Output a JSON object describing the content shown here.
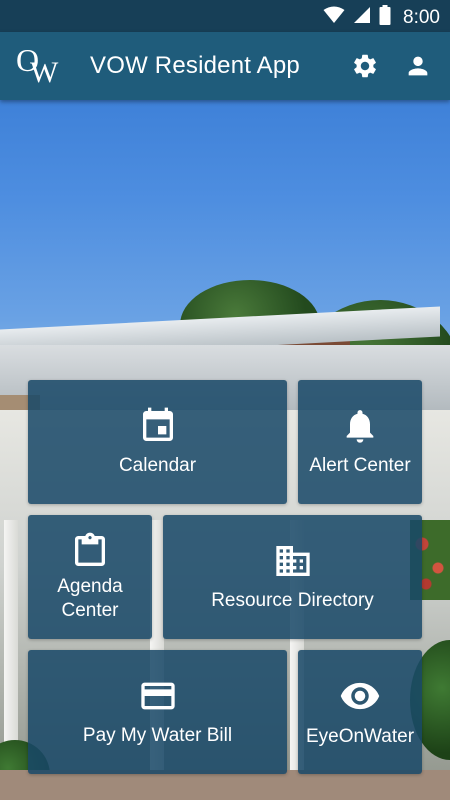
{
  "status_bar": {
    "time": "8:00",
    "icons": [
      "wifi-icon",
      "cellular-signal-icon",
      "battery-icon"
    ]
  },
  "app_bar": {
    "logo_letters": [
      "O",
      "W"
    ],
    "title": "VOW Resident App",
    "actions": [
      "settings-gear-icon",
      "account-person-icon"
    ]
  },
  "tiles": [
    {
      "label": "Calendar",
      "icon": "calendar-icon"
    },
    {
      "label": "Alert Center",
      "icon": "bell-icon"
    },
    {
      "label": "Agenda\nCenter",
      "icon": "clipboard-icon"
    },
    {
      "label": "Resource Directory",
      "icon": "building-icon"
    },
    {
      "label": "Pay My Water Bill",
      "icon": "credit-card-icon"
    },
    {
      "label": "EyeOnWater",
      "icon": "eye-icon"
    }
  ],
  "colors": {
    "status_bar": "#173f57",
    "app_bar": "#1f5c7b",
    "tile": "#184868"
  }
}
